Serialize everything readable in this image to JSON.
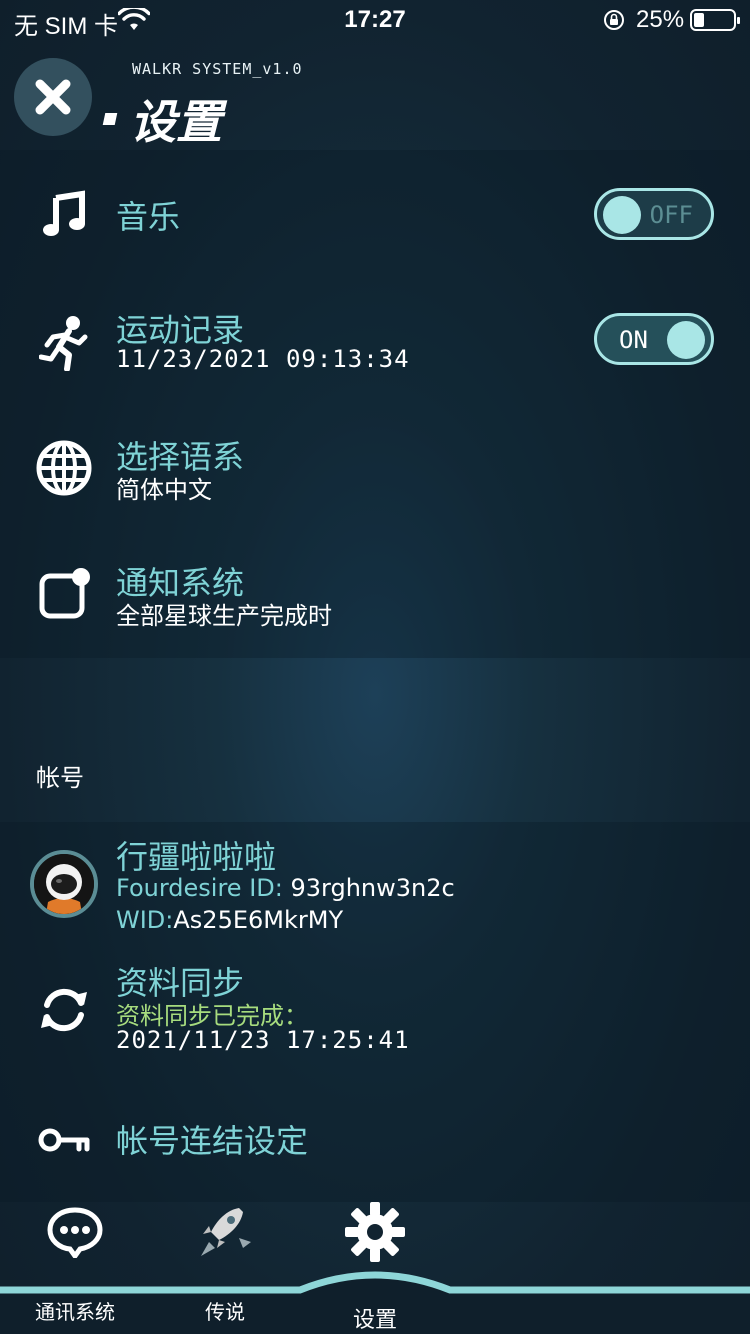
{
  "status_bar": {
    "carrier": "无 SIM 卡",
    "time": "17:27",
    "battery": "25%",
    "battery_level": 0.25
  },
  "header": {
    "system_name": "WALKR SYSTEM_v1.0",
    "title": "设置",
    "close_icon": "close-icon"
  },
  "settings": {
    "music": {
      "label": "音乐",
      "toggle": "OFF",
      "icon": "music-note-icon"
    },
    "activity": {
      "label": "运动记录",
      "subtitle": "11/23/2021 09:13:34",
      "toggle": "ON",
      "icon": "running-man-icon"
    },
    "language": {
      "label": "选择语系",
      "subtitle": "简体中文",
      "icon": "globe-icon"
    },
    "notification": {
      "label": "通知系统",
      "subtitle": "全部星球生产完成时",
      "icon": "notification-icon"
    }
  },
  "account": {
    "section_label": "帐号",
    "profile": {
      "name": "行疆啦啦啦",
      "fourdesire_label": "Fourdesire ID: ",
      "fourdesire_id": "93rghnw3n2c",
      "wid_label": "WID:",
      "wid": "As25E6MkrMY"
    },
    "sync": {
      "label": "资料同步",
      "status": "资料同步已完成：",
      "timestamp": "2021/11/23 17:25:41",
      "icon": "sync-icon"
    },
    "link": {
      "label": "帐号连结设定",
      "icon": "key-icon"
    }
  },
  "tabs": [
    {
      "label": "通讯系统",
      "icon": "chat-bubble-icon"
    },
    {
      "label": "传说",
      "icon": "rocket-icon"
    },
    {
      "label": "设置",
      "icon": "gear-icon",
      "active": true
    }
  ],
  "colors": {
    "accent": "#7fd3d6",
    "toggle": "#a9e6e6",
    "success": "#a7dc7e",
    "background": "#112330"
  }
}
